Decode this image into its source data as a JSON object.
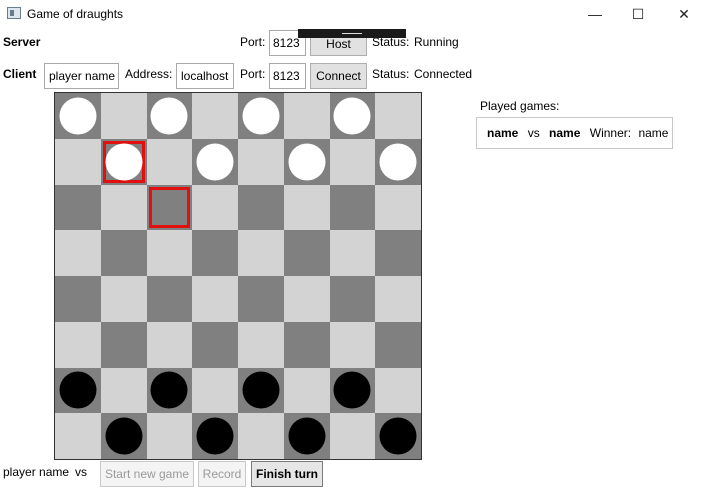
{
  "window": {
    "title": "Game of draughts",
    "minimize_glyph": "—",
    "maximize_glyph": "☐",
    "close_glyph": "✕"
  },
  "server": {
    "label": "Server",
    "port_label": "Port:",
    "port_value": "8123",
    "host_button": "Host",
    "status_label": "Status:",
    "status_value": "Running"
  },
  "client": {
    "label": "Client",
    "player_name_value": "player name",
    "address_label": "Address:",
    "address_value": "localhost",
    "port_label": "Port:",
    "port_value": "8123",
    "connect_button": "Connect",
    "status_label": "Status:",
    "status_value": "Connected"
  },
  "board": {
    "rows": [
      [
        "W",
        "",
        "W",
        "",
        "W",
        "",
        "W",
        ""
      ],
      [
        "",
        "W",
        "",
        "W",
        "",
        "W",
        "",
        "W"
      ],
      [
        "",
        "",
        "",
        "",
        "",
        "",
        "",
        ""
      ],
      [
        "",
        "",
        "",
        "",
        "",
        "",
        "",
        ""
      ],
      [
        "",
        "",
        "",
        "",
        "",
        "",
        "",
        ""
      ],
      [
        "",
        "",
        "",
        "",
        "",
        "",
        "",
        ""
      ],
      [
        "B",
        "",
        "B",
        "",
        "B",
        "",
        "B",
        ""
      ],
      [
        "",
        "B",
        "",
        "B",
        "",
        "B",
        "",
        "B"
      ]
    ],
    "selected": [
      [
        1,
        1
      ],
      [
        2,
        2
      ]
    ],
    "colors": {
      "dark": "#808080",
      "light": "#d3d3d3",
      "highlight": "#e01010"
    }
  },
  "played_games": {
    "label": "Played games:",
    "entries": [
      {
        "player1": "name",
        "vs": "vs",
        "player2": "name",
        "winner_label": "Winner:",
        "winner": "name"
      }
    ]
  },
  "footer": {
    "player_name": "player name",
    "vs": "vs",
    "start_new_game": "Start new game",
    "record": "Record",
    "finish_turn": "Finish turn"
  }
}
